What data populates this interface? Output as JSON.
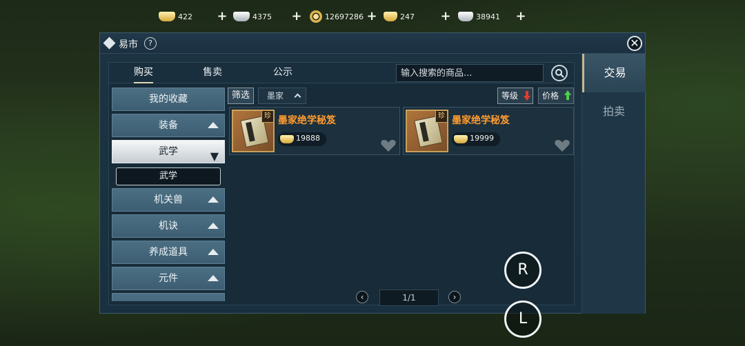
{
  "currencies": [
    {
      "icon": "gold-ingot-icon",
      "value": "422"
    },
    {
      "icon": "silver-ingot-icon",
      "value": "4375"
    },
    {
      "icon": "copper-coin-icon",
      "value": "12697286"
    },
    {
      "icon": "small-gold-ingot-icon",
      "value": "247"
    },
    {
      "icon": "silver-ingot-icon",
      "value": "38941"
    }
  ],
  "window": {
    "title": "易市",
    "help": "?"
  },
  "top_tabs": [
    "购买",
    "售卖",
    "公示"
  ],
  "search": {
    "placeholder": "输入搜索的商品..."
  },
  "side_tabs": {
    "active": "交易",
    "inactive": "拍卖"
  },
  "categories": {
    "favorites": "我的收藏",
    "equipment": "装备",
    "martial": "武学",
    "martial_sub": "武学",
    "beast": "机关兽",
    "skill": "机诀",
    "items": "养成道具",
    "parts": "元件"
  },
  "filter": {
    "label": "筛选",
    "selected": "墨家",
    "sort_level": "等级",
    "sort_price": "价格"
  },
  "items": [
    {
      "name": "墨家绝学秘笈",
      "rarity": "珍",
      "price": "19888"
    },
    {
      "name": "墨家绝学秘笈",
      "rarity": "珍",
      "price": "19999"
    }
  ],
  "pagination": {
    "current": "1/1"
  },
  "controls": {
    "r": "R",
    "l": "L"
  },
  "colors": {
    "item_name": "#ff9b2f",
    "sort_down": "#e43b2f",
    "sort_up": "#4fcf4a"
  }
}
